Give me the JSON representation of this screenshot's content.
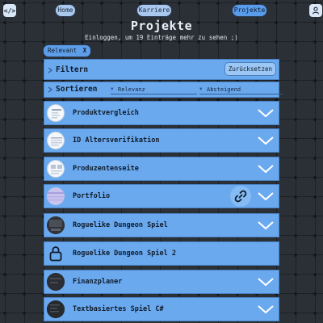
{
  "nav": {
    "code_icon": "</>",
    "items": [
      {
        "label": "Home",
        "active": false
      },
      {
        "label": "Karriere",
        "active": false
      },
      {
        "label": "Projekte",
        "active": true
      }
    ],
    "user_icon": "user-icon"
  },
  "header": {
    "title": "Projekte",
    "subtitle": "Einloggen, um 19 Einträge mehr zu sehen ;)"
  },
  "active_filter_chip": {
    "label": "Relevant",
    "remove": "X"
  },
  "filter": {
    "label": "Filtern",
    "reset_label": "Zurücksetzen"
  },
  "sort": {
    "label": "Sortieren",
    "by_value": "Relevanz",
    "order_value": "Absteigend"
  },
  "projects": [
    {
      "title": "Produktvergleich",
      "thumb": "white-document"
    },
    {
      "title": "ID Altersverifikation",
      "thumb": "white-document"
    },
    {
      "title": "Produzentenseite",
      "thumb": "white-document"
    },
    {
      "title": "Portfolio",
      "thumb": "lavender-page",
      "has_link": true
    },
    {
      "title": "Roguelike Dungeon Spiel",
      "thumb": "dark-screenshot"
    },
    {
      "title": "Roguelike Dungeon Spiel 2",
      "thumb": "lock-icon"
    },
    {
      "title": "Finanzplaner",
      "thumb": "dark-screenshot"
    },
    {
      "title": "Textbasiertes Spiel C#",
      "thumb": "dark-screenshot"
    }
  ],
  "colors": {
    "accent": "#5a9cec",
    "row_bg": "#6ba9ef",
    "row_border": "#4a82c4",
    "background": "#2b3036"
  }
}
